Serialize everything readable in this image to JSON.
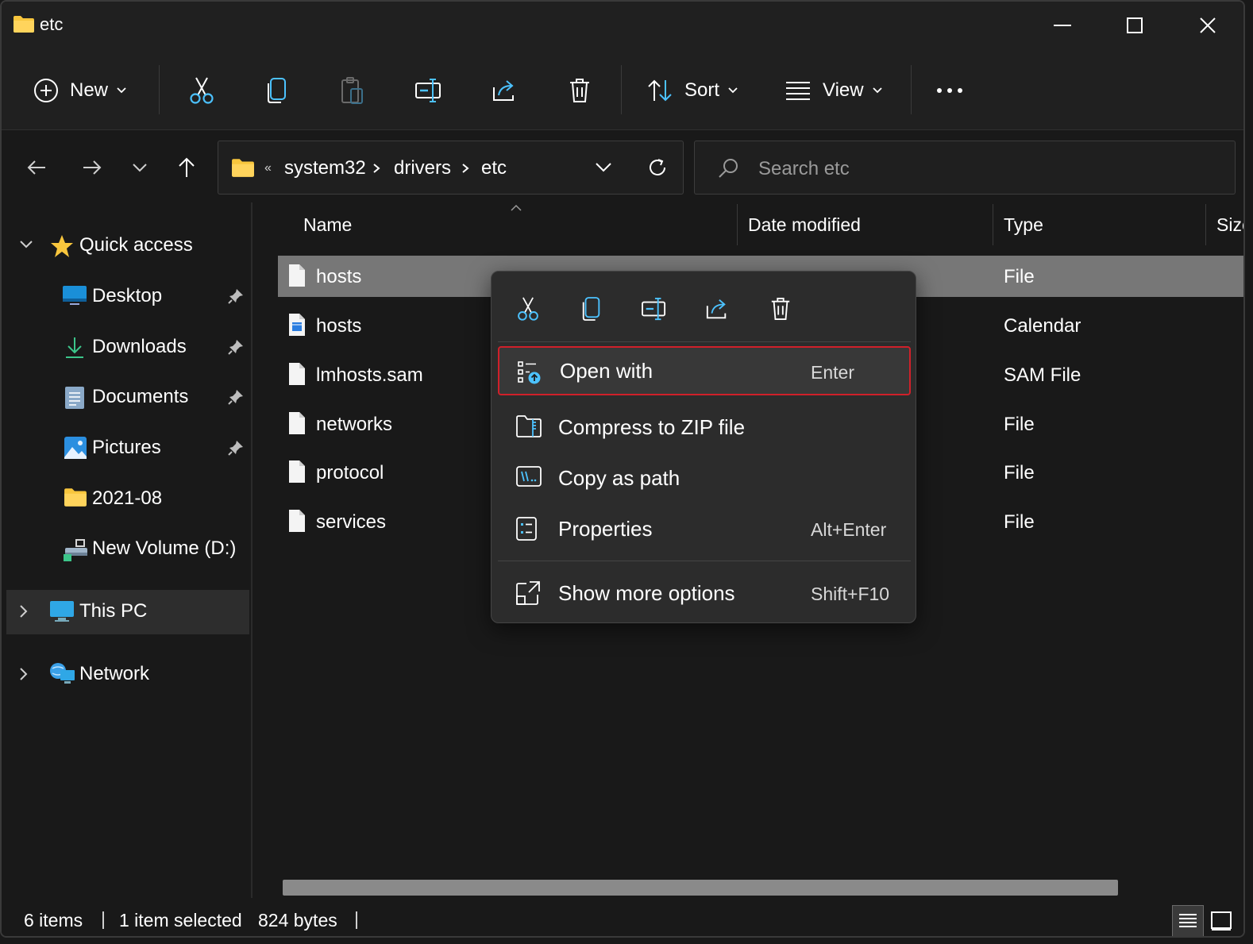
{
  "window": {
    "title": "etc"
  },
  "toolbar": {
    "new_label": "New",
    "sort_label": "Sort",
    "view_label": "View",
    "icons": [
      "add-icon",
      "cut-icon",
      "copy-icon",
      "paste-icon",
      "rename-icon",
      "share-icon",
      "delete-icon",
      "sort-icon",
      "view-icon",
      "more-icon"
    ]
  },
  "address": {
    "overflow": "«",
    "crumbs": [
      "system32",
      "drivers",
      "etc"
    ]
  },
  "search": {
    "placeholder": "Search etc"
  },
  "sidebar": {
    "quick_access": "Quick access",
    "items": [
      {
        "label": "Desktop",
        "icon": "desktop-icon",
        "pinned": true
      },
      {
        "label": "Downloads",
        "icon": "downloads-icon",
        "pinned": true
      },
      {
        "label": "Documents",
        "icon": "documents-icon",
        "pinned": true
      },
      {
        "label": "Pictures",
        "icon": "pictures-icon",
        "pinned": true
      },
      {
        "label": "2021-08",
        "icon": "folder-icon",
        "pinned": false
      },
      {
        "label": "New Volume (D:)",
        "icon": "drive-icon",
        "pinned": false
      }
    ],
    "this_pc": "This PC",
    "network": "Network"
  },
  "columns": [
    "Name",
    "Date modified",
    "Type",
    "Size"
  ],
  "files": [
    {
      "name": "hosts",
      "type": "File",
      "selected": true,
      "icon": "file-icon"
    },
    {
      "name": "hosts",
      "type": "Calendar",
      "selected": false,
      "icon": "calendar-file-icon"
    },
    {
      "name": "lmhosts.sam",
      "type": "SAM File",
      "selected": false,
      "icon": "file-icon"
    },
    {
      "name": "networks",
      "type": "File",
      "selected": false,
      "icon": "file-icon"
    },
    {
      "name": "protocol",
      "type": "File",
      "selected": false,
      "icon": "file-icon"
    },
    {
      "name": "services",
      "type": "File",
      "selected": false,
      "icon": "file-icon"
    }
  ],
  "context_menu": {
    "toolbar_icons": [
      "cut-icon",
      "copy-icon",
      "rename-icon",
      "share-icon",
      "delete-icon"
    ],
    "items": [
      {
        "label": "Open with",
        "shortcut": "Enter",
        "icon": "open-with-icon",
        "highlighted": true
      },
      {
        "label": "Compress to ZIP file",
        "shortcut": "",
        "icon": "zip-icon",
        "highlighted": false
      },
      {
        "label": "Copy as path",
        "shortcut": "",
        "icon": "copy-path-icon",
        "highlighted": false
      },
      {
        "label": "Properties",
        "shortcut": "Alt+Enter",
        "icon": "properties-icon",
        "highlighted": false
      },
      {
        "label": "Show more options",
        "shortcut": "Shift+F10",
        "icon": "more-options-icon",
        "highlighted": false
      }
    ]
  },
  "status": {
    "item_count": "6 items",
    "selection": "1 item selected",
    "size": "824 bytes"
  },
  "colors": {
    "accent": "#4cc2ff",
    "folder": "#f8c63d",
    "highlight_border": "#d0202a",
    "selected_row": "#777777"
  }
}
